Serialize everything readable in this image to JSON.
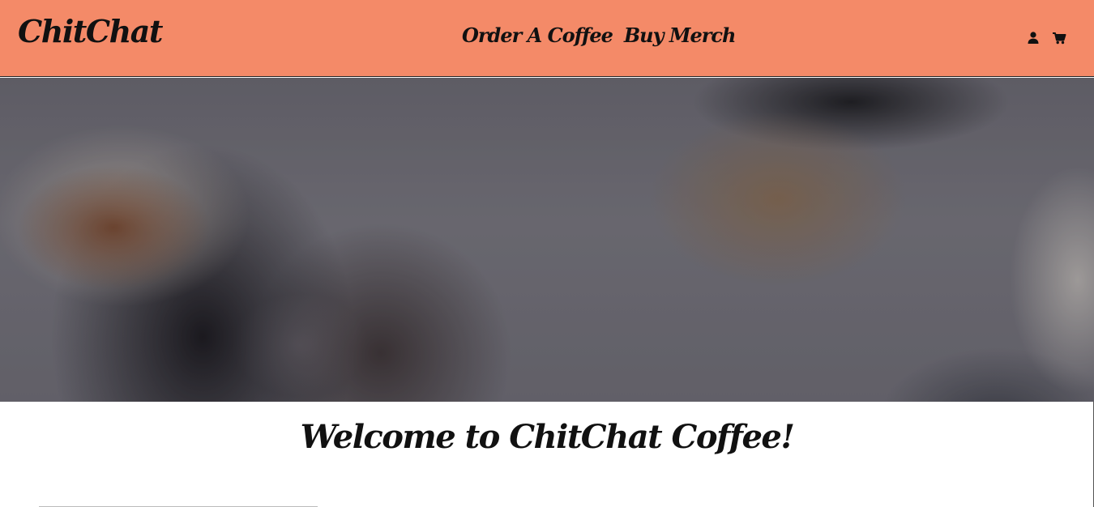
{
  "navbar": {
    "brand": "ChitChat",
    "links": [
      {
        "label": "Order A Coffee"
      },
      {
        "label": "Buy Merch"
      }
    ],
    "icons": [
      "user-icon",
      "cart-icon"
    ],
    "background": "#f48a68"
  },
  "main": {
    "welcome_heading": "Welcome to ChitChat Coffee!"
  }
}
